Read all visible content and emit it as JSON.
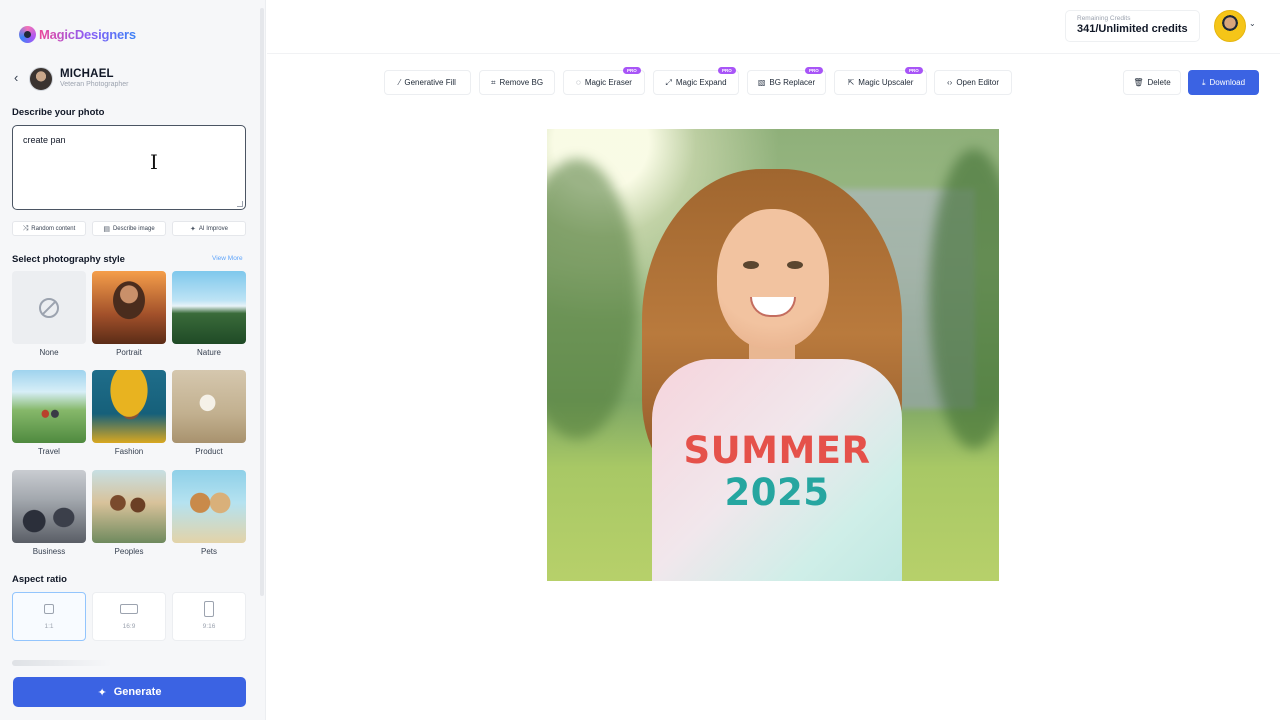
{
  "brand": {
    "name": "MagicDesigners"
  },
  "profile": {
    "name": "MICHAEL",
    "role": "Veteran Photographer"
  },
  "prompt": {
    "title": "Describe your photo",
    "value": "create pan"
  },
  "prompt_actions": [
    {
      "label": "Random content",
      "icon": "shuffle-icon"
    },
    {
      "label": "Describe image",
      "icon": "image-text-icon"
    },
    {
      "label": "AI Improve",
      "icon": "sparkle-icon"
    }
  ],
  "styles": {
    "title": "Select photography style",
    "view_more": "View More",
    "items": [
      {
        "label": "None"
      },
      {
        "label": "Portrait"
      },
      {
        "label": "Nature"
      },
      {
        "label": "Travel"
      },
      {
        "label": "Fashion"
      },
      {
        "label": "Product"
      },
      {
        "label": "Business"
      },
      {
        "label": "Peoples"
      },
      {
        "label": "Pets"
      }
    ]
  },
  "aspect": {
    "title": "Aspect ratio",
    "options": [
      {
        "label": "1:1",
        "selected": true
      },
      {
        "label": "16:9",
        "selected": false
      },
      {
        "label": "9:16",
        "selected": false
      }
    ]
  },
  "generate_label": "Generate",
  "credits": {
    "label": "Remaining Credits",
    "value": "341/Unlimited credits"
  },
  "toolbar": {
    "tools": [
      {
        "label": "Generative Fill",
        "icon": "wand-icon",
        "pro": false
      },
      {
        "label": "Remove BG",
        "icon": "remove-bg-icon",
        "pro": false
      },
      {
        "label": "Magic Eraser",
        "icon": "eraser-icon",
        "pro": true
      },
      {
        "label": "Magic Expand",
        "icon": "expand-icon",
        "pro": true
      },
      {
        "label": "BG Replacer",
        "icon": "bg-replace-icon",
        "pro": true
      },
      {
        "label": "Magic Upscaler",
        "icon": "upscale-icon",
        "pro": true
      },
      {
        "label": "Open Editor",
        "icon": "code-icon",
        "pro": false
      }
    ],
    "pro_badge": "PRO",
    "delete_label": "Delete",
    "download_label": "Download"
  },
  "photo": {
    "shirt_line1": "SUMMER",
    "shirt_line2": "2025"
  },
  "colors": {
    "accent": "#3b63e3",
    "pro": "#a855f7"
  }
}
